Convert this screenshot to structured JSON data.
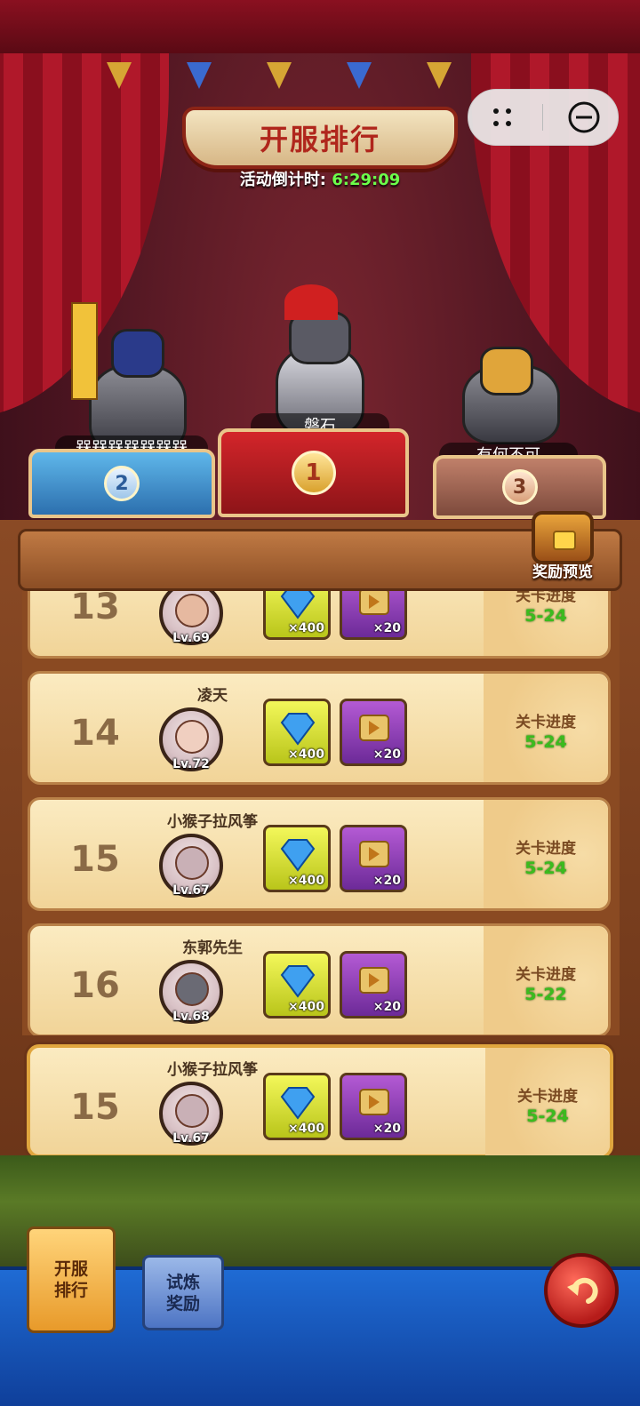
{
  "header": {
    "title": "开服排行",
    "countdown_label": "活动倒计时:",
    "countdown_value": "6:29:09"
  },
  "capsule": {
    "menu_icon": "more-dots-icon",
    "close_icon": "minimize-circle-icon"
  },
  "podium": [
    {
      "rank": "2",
      "name": "槑槑槑槑槑槑槑"
    },
    {
      "rank": "1",
      "name": "磐石"
    },
    {
      "rank": "3",
      "name": "有何不可"
    }
  ],
  "reward_preview_label": "奖励预览",
  "progress_label": "关卡进度",
  "rows": [
    {
      "rank": "13",
      "name": "",
      "level": "Lv.69",
      "gem_qty": "×400",
      "scroll_qty": "×20",
      "progress_label": "关卡进度",
      "progress": "5-24"
    },
    {
      "rank": "14",
      "name": "凌天",
      "level": "Lv.72",
      "gem_qty": "×400",
      "scroll_qty": "×20",
      "progress_label": "关卡进度",
      "progress": "5-24"
    },
    {
      "rank": "15",
      "name": "小猴子拉风筝",
      "level": "Lv.67",
      "gem_qty": "×400",
      "scroll_qty": "×20",
      "progress_label": "关卡进度",
      "progress": "5-24"
    },
    {
      "rank": "16",
      "name": "东郭先生",
      "level": "Lv.68",
      "gem_qty": "×400",
      "scroll_qty": "×20",
      "progress_label": "关卡进度",
      "progress": "5-22"
    }
  ],
  "my_row": {
    "rank": "15",
    "name": "小猴子拉风筝",
    "level": "Lv.67",
    "gem_qty": "×400",
    "scroll_qty": "×20",
    "progress_label": "关卡进度",
    "progress": "5-24"
  },
  "tabs": [
    {
      "label": "开服\n排行",
      "line1": "开服",
      "line2": "排行"
    },
    {
      "label": "试炼\n奖励",
      "line1": "试炼",
      "line2": "奖励"
    }
  ],
  "colors": {
    "progress_green": "#3bbb1e",
    "title_red": "#b0261c",
    "countdown_green": "#6cff4a"
  }
}
